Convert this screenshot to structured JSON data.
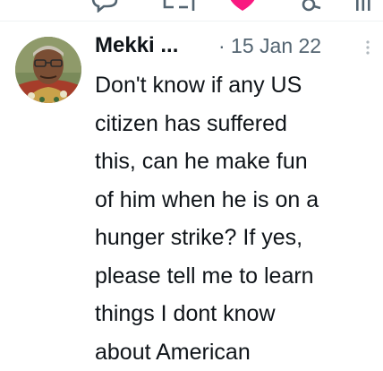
{
  "tweet": {
    "author_name": "Mekki ...",
    "date": "· 15 Jan 22",
    "text": "Don't know if any US\ncitizen has suffered\nthis, can he make fun\nof him when he is on a\nhunger strike? If yes,\nplease tell me to learn\nthings I dont know\nabout American"
  },
  "actions": {
    "icons": [
      "reply-icon",
      "retweet-icon",
      "like-icon",
      "share-icon",
      "analytics-icon"
    ]
  },
  "colors": {
    "like_active": "#f91880",
    "icon_gray": "#536471",
    "text": "#0f1419",
    "divider": "#eff3f4"
  }
}
